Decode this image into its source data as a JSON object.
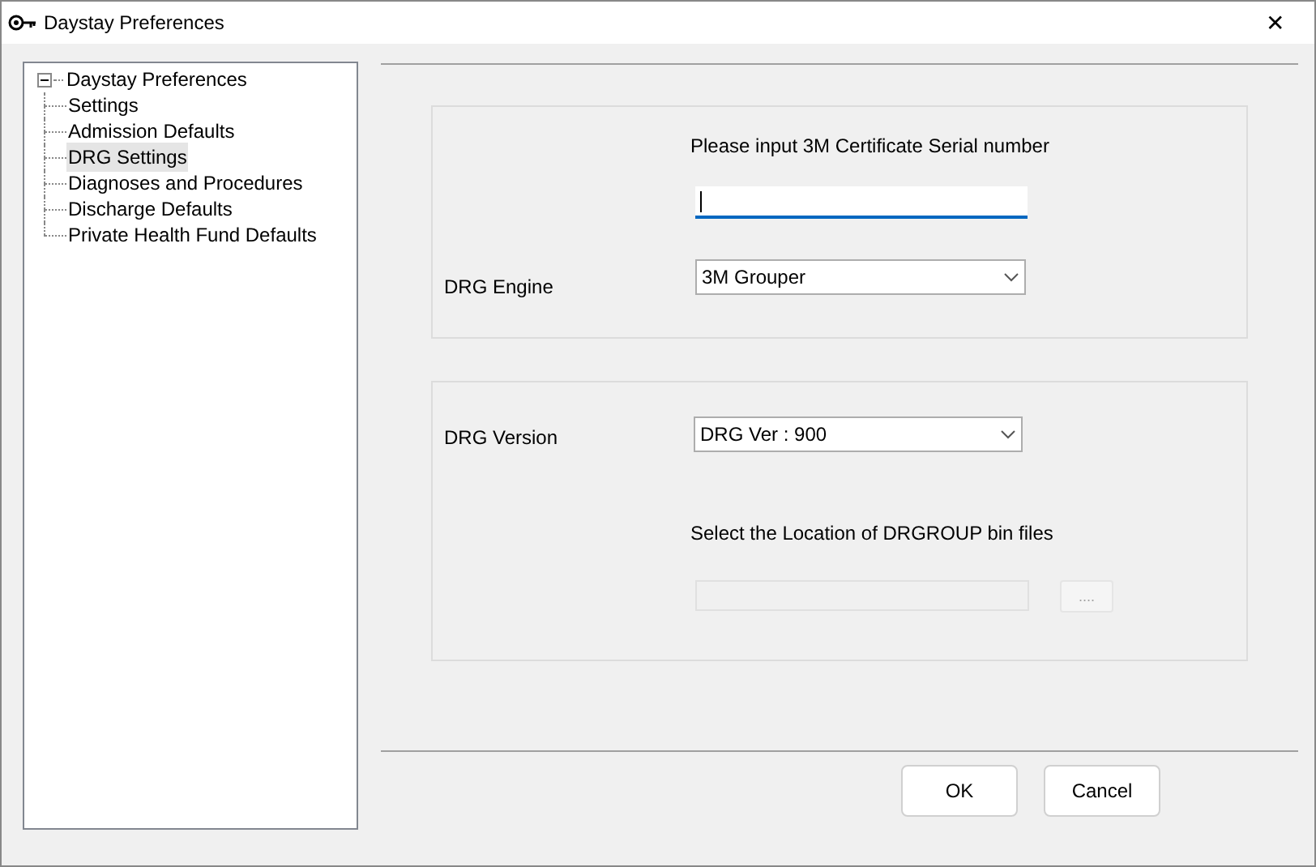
{
  "window": {
    "title": "Daystay Preferences",
    "close": "✕"
  },
  "tree": {
    "label": "Daystay Preferences",
    "expanded": true,
    "children": [
      {
        "label": "Settings",
        "selected": false
      },
      {
        "label": "Admission Defaults",
        "selected": false
      },
      {
        "label": "DRG Settings",
        "selected": true
      },
      {
        "label": "Diagnoses and Procedures",
        "selected": false
      },
      {
        "label": "Discharge Defaults",
        "selected": false
      },
      {
        "label": "Private Health Fund Defaults",
        "selected": false
      }
    ]
  },
  "serial": {
    "label": "Please input 3M Certificate Serial number",
    "focused": true
  },
  "engine": {
    "label": "DRG Engine",
    "value": "3M Grouper"
  },
  "version": {
    "label": "DRG Version",
    "value": "DRG Ver : 900"
  },
  "location": {
    "label": "Select the Location of DRGROUP bin files",
    "disabled": true,
    "browse": {
      "label": "....",
      "disabled": true
    }
  },
  "buttons": [
    "OK",
    "Cancel"
  ]
}
